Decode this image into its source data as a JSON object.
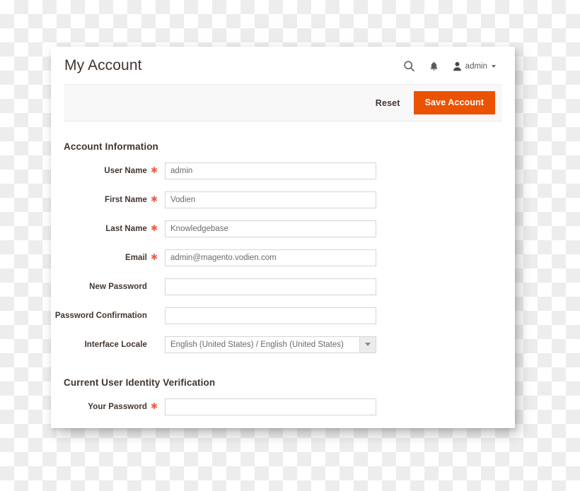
{
  "page": {
    "title": "My Account"
  },
  "header": {
    "search_icon": "search-icon",
    "notifications_icon": "bell-icon",
    "user_label": "admin",
    "avatar_icon": "user-avatar-icon",
    "caret_icon": "chevron-down-icon"
  },
  "toolbar": {
    "reset_label": "Reset",
    "save_label": "Save Account",
    "save_color": "#eb5202"
  },
  "sections": [
    {
      "legend": "Account Information",
      "fields": [
        {
          "label": "User Name",
          "required": true,
          "value": "admin",
          "placeholder": "",
          "type": "text"
        },
        {
          "label": "First Name",
          "required": true,
          "value": "Vodien",
          "placeholder": "",
          "type": "text"
        },
        {
          "label": "Last Name",
          "required": true,
          "value": "Knowledgebase",
          "placeholder": "",
          "type": "text"
        },
        {
          "label": "Email",
          "required": true,
          "value": "admin@magento.vodien.com",
          "placeholder": "",
          "type": "text"
        },
        {
          "label": "New Password",
          "required": false,
          "value": "",
          "placeholder": "",
          "type": "password"
        },
        {
          "label": "Password Confirmation",
          "required": false,
          "value": "",
          "placeholder": "",
          "type": "password"
        },
        {
          "label": "Interface Locale",
          "required": false,
          "value": "English (United States) / English (United States)",
          "type": "select"
        }
      ]
    },
    {
      "legend": "Current User Identity Verification",
      "fields": [
        {
          "label": "Your Password",
          "required": true,
          "value": "",
          "placeholder": "",
          "type": "password"
        }
      ]
    }
  ],
  "colors": {
    "accent": "#eb5202",
    "required_star": "#e9604c",
    "text": "#41362f",
    "toolbar_bg": "#f8f8f8"
  }
}
